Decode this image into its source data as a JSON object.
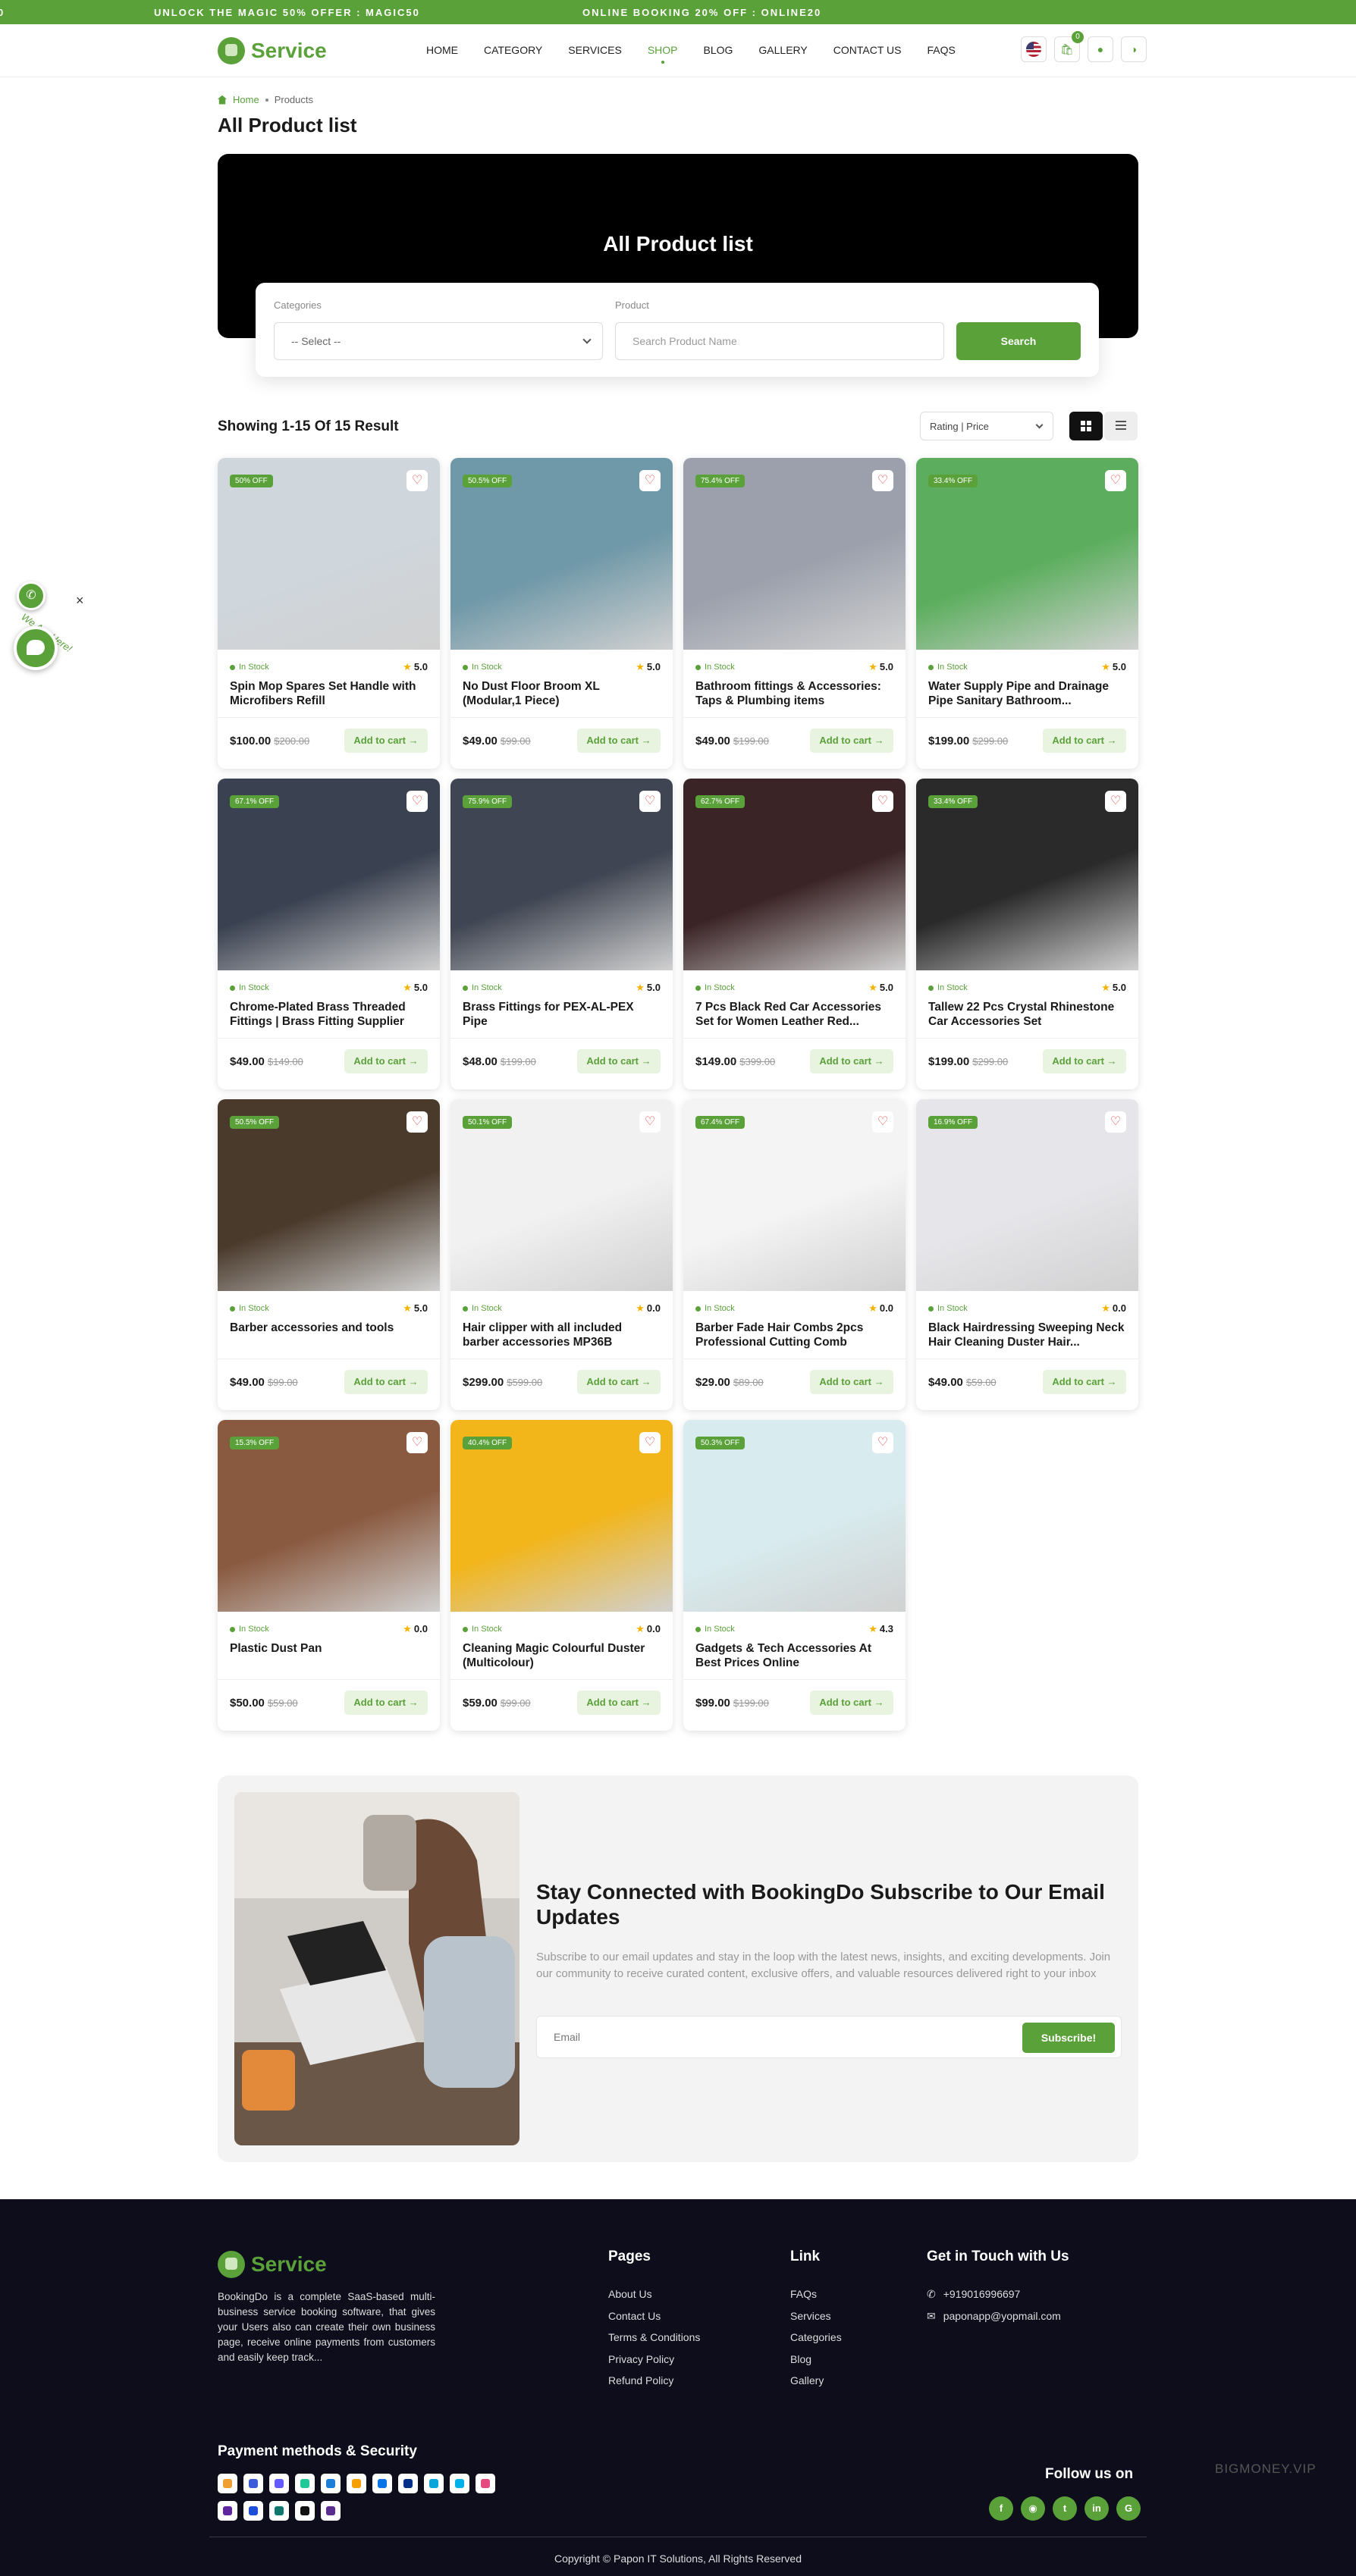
{
  "promo": {
    "left_text": "UNLOCK THE MAGIC 50% OFFER : MAGIC50",
    "right_text": "ONLINE BOOKING 20% OFF : ONLINE20",
    "cut_text": "0"
  },
  "brand": {
    "name": "Service",
    "accent": "#5aa13a"
  },
  "nav": [
    {
      "label": "HOME",
      "active": false
    },
    {
      "label": "CATEGORY",
      "active": false
    },
    {
      "label": "SERVICES",
      "active": false
    },
    {
      "label": "SHOP",
      "active": true
    },
    {
      "label": "BLOG",
      "active": false
    },
    {
      "label": "GALLERY",
      "active": false
    },
    {
      "label": "CONTACT US",
      "active": false
    },
    {
      "label": "FAQS",
      "active": false
    }
  ],
  "header_icons": {
    "language": "us-flag-icon",
    "cart_count": "0",
    "cart": "bag-icon",
    "user": "user-icon",
    "theme": "contrast-icon"
  },
  "breadcrumb": {
    "home": "Home",
    "current": "Products"
  },
  "page_title": "All Product list",
  "hero": {
    "title": "All Product list",
    "categories_label": "Categories",
    "categories_value": "-- Select --",
    "product_label": "Product",
    "product_placeholder": "Search Product Name",
    "search_button": "Search"
  },
  "toolbar": {
    "result_text": "Showing 1-15 Of 15 Result",
    "sort_value": "Rating | Price",
    "grid_view": "grid-icon",
    "list_view": "list-icon"
  },
  "products": [
    {
      "badge": "50% OFF",
      "stock": "In Stock",
      "rating": "5.0",
      "name": "Spin Mop Spares Set Handle with Microfibers Refill",
      "price": "$100.00",
      "old_price": "$200.00",
      "cta": "Add to cart →",
      "image": "spin-mop-photo",
      "color": "#cfd6dc"
    },
    {
      "badge": "50.5% OFF",
      "stock": "In Stock",
      "rating": "5.0",
      "name": "No Dust Floor Broom XL (Modular,1 Piece)",
      "price": "$49.00",
      "old_price": "$99.00",
      "cta": "Add to cart →",
      "image": "broom-photo",
      "color": "#6f98a8"
    },
    {
      "badge": "75.4% OFF",
      "stock": "In Stock",
      "rating": "5.0",
      "name": "Bathroom fittings & Accessories: Taps & Plumbing items",
      "price": "$49.00",
      "old_price": "$199.00",
      "cta": "Add to cart →",
      "image": "brass-fittings-photo",
      "color": "#9ba0ac"
    },
    {
      "badge": "33.4% OFF",
      "stock": "In Stock",
      "rating": "5.0",
      "name": "Water Supply Pipe and Drainage Pipe Sanitary Bathroom...",
      "price": "$199.00",
      "old_price": "$299.00",
      "cta": "Add to cart →",
      "image": "green-pipes-photo",
      "color": "#5cae5e"
    },
    {
      "badge": "67.1% OFF",
      "stock": "In Stock",
      "rating": "5.0",
      "name": "Chrome-Plated Brass Threaded Fittings | Brass Fitting Supplier",
      "price": "$49.00",
      "old_price": "$149.00",
      "cta": "Add to cart →",
      "image": "chrome-fittings-photo",
      "color": "#3a4150"
    },
    {
      "badge": "75.9% OFF",
      "stock": "In Stock",
      "rating": "5.0",
      "name": "Brass Fittings for PEX-AL-PEX Pipe",
      "price": "$48.00",
      "old_price": "$199.00",
      "cta": "Add to cart →",
      "image": "pex-fittings-photo",
      "color": "#3f4552"
    },
    {
      "badge": "62.7% OFF",
      "stock": "In Stock",
      "rating": "5.0",
      "name": "7 Pcs Black Red Car Accessories Set for Women Leather Red...",
      "price": "$149.00",
      "old_price": "$399.00",
      "cta": "Add to cart →",
      "image": "car-accessories-photo",
      "color": "#3b2426"
    },
    {
      "badge": "33.4% OFF",
      "stock": "In Stock",
      "rating": "5.0",
      "name": "Tallew 22 Pcs Crystal Rhinestone Car Accessories Set",
      "price": "$199.00",
      "old_price": "$299.00",
      "cta": "Add to cart →",
      "image": "rhinestone-set-photo",
      "color": "#2a2a2a"
    },
    {
      "badge": "50.5% OFF",
      "stock": "In Stock",
      "rating": "5.0",
      "name": "Barber accessories and tools",
      "price": "$49.00",
      "old_price": "$99.00",
      "cta": "Add to cart →",
      "image": "barber-tools-photo",
      "color": "#4a3a2c"
    },
    {
      "badge": "50.1% OFF",
      "stock": "In Stock",
      "rating": "0.0",
      "name": "Hair clipper with all included barber accessories MP36B",
      "price": "$299.00",
      "old_price": "$599.00",
      "cta": "Add to cart →",
      "image": "hair-clipper-photo",
      "color": "#f1f1f1"
    },
    {
      "badge": "67.4% OFF",
      "stock": "In Stock",
      "rating": "0.0",
      "name": "Barber Fade Hair Combs 2pcs Professional Cutting Comb",
      "price": "$29.00",
      "old_price": "$89.00",
      "cta": "Add to cart →",
      "image": "hair-combs-photo",
      "color": "#f4f4f4"
    },
    {
      "badge": "16.9% OFF",
      "stock": "In Stock",
      "rating": "0.0",
      "name": "Black Hairdressing Sweeping Neck Hair Cleaning Duster Hair...",
      "price": "$49.00",
      "old_price": "$59.00",
      "cta": "Add to cart →",
      "image": "neck-duster-photo",
      "color": "#e6e6ea"
    },
    {
      "badge": "15.3% OFF",
      "stock": "In Stock",
      "rating": "0.0",
      "name": "Plastic Dust Pan",
      "price": "$50.00",
      "old_price": "$59.00",
      "cta": "Add to cart →",
      "image": "dust-pan-photo",
      "color": "#8a5a40"
    },
    {
      "badge": "40.4% OFF",
      "stock": "In Stock",
      "rating": "0.0",
      "name": "Cleaning Magic Colourful Duster (Multicolour)",
      "price": "$59.00",
      "old_price": "$99.00",
      "cta": "Add to cart →",
      "image": "color-duster-photo",
      "color": "#f2b51a"
    },
    {
      "badge": "50.3% OFF",
      "stock": "In Stock",
      "rating": "4.3",
      "name": "Gadgets & Tech Accessories At Best Prices Online",
      "price": "$99.00",
      "old_price": "$199.00",
      "cta": "Add to cart →",
      "image": "gadget-photo",
      "color": "#d8ecef"
    }
  ],
  "chat": {
    "close": "×",
    "label": "We Are Here!"
  },
  "subscribe": {
    "title": "Stay Connected with BookingDo Subscribe to Our Email Updates",
    "text": "Subscribe to our email updates and stay in the loop with the latest news, insights, and exciting developments. Join our community to receive curated content, exclusive offers, and valuable resources delivered right to your inbox",
    "placeholder": "Email",
    "button": "Subscribe!"
  },
  "footer": {
    "brand": "Service",
    "description": "BookingDo is a complete SaaS-based multi-business service booking software, that gives your Users also can create their own business page, receive online payments from customers and easily keep track...",
    "pages_title": "Pages",
    "pages": [
      "About Us",
      "Contact Us",
      "Terms & Conditions",
      "Privacy Policy",
      "Refund Policy"
    ],
    "link_title": "Link",
    "links": [
      "FAQs",
      "Services",
      "Categories",
      "Blog",
      "Gallery"
    ],
    "contact_title": "Get in Touch with Us",
    "phone": "+919016996697",
    "email": "paponapp@yopmail.com",
    "payment_title": "Payment methods & Security",
    "follow_title": "Follow us on",
    "socials": [
      "facebook-icon",
      "instagram-icon",
      "twitter-icon",
      "linkedin-icon",
      "google-icon"
    ],
    "copyright": "Copyright © Papon IT Solutions, All Rights Reserved",
    "watermark": "BIGMONEY.VIP"
  }
}
